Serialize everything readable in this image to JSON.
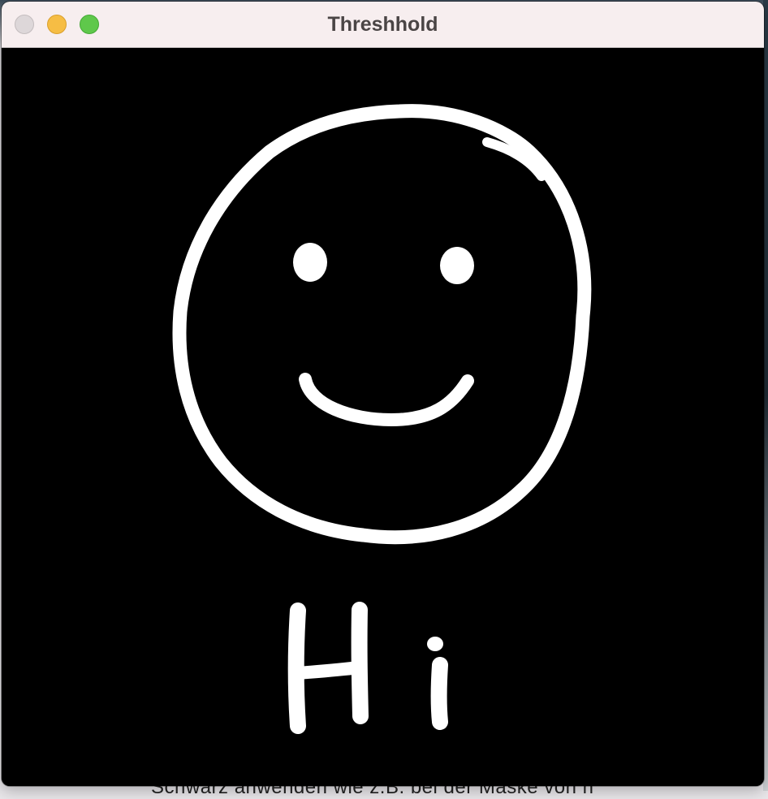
{
  "window": {
    "title": "Threshhold",
    "controls": {
      "close": "close-button",
      "minimize": "minimize-button",
      "zoom": "zoom-button"
    }
  },
  "canvas": {
    "background": "#000000",
    "drawing_color": "#ffffff",
    "drawing_content": "smiley face with text",
    "drawn_text": "Hi"
  },
  "background_window": {
    "partial_text": "Schwarz anwenden wie z.B. bei der Maske von h"
  },
  "colors": {
    "titlebar": "#f7eeef",
    "close": "#ddd7d9",
    "minimize": "#f6bd44",
    "zoom": "#5fc84b"
  }
}
